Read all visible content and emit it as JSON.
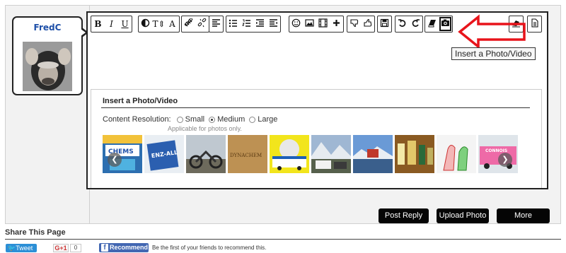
{
  "user": {
    "name": "FredC"
  },
  "toolbar": {
    "groups": [
      {
        "buttons": [
          {
            "name": "bold-button",
            "glyph": "B",
            "cls": "b"
          },
          {
            "name": "italic-button",
            "glyph": "I",
            "cls": "i"
          },
          {
            "name": "underline-button",
            "glyph": "U",
            "cls": "u"
          }
        ]
      },
      {
        "buttons": [
          {
            "name": "color-button",
            "icon": "half-circle"
          },
          {
            "name": "font-size-button",
            "glyph": "T⇕"
          },
          {
            "name": "font-button",
            "glyph": "A"
          }
        ]
      },
      {
        "buttons": [
          {
            "name": "link-button",
            "icon": "link"
          },
          {
            "name": "unlink-button",
            "icon": "unlink"
          }
        ]
      },
      {
        "buttons": [
          {
            "name": "align-button",
            "icon": "align-left"
          }
        ]
      },
      {
        "buttons": [
          {
            "name": "bullet-list-button",
            "icon": "ul"
          },
          {
            "name": "numbered-list-button",
            "icon": "ol"
          },
          {
            "name": "outdent-button",
            "icon": "outdent"
          },
          {
            "name": "indent-button",
            "icon": "indent"
          }
        ]
      },
      {
        "buttons": [
          {
            "name": "smilie-button",
            "icon": "smile"
          },
          {
            "name": "image-button",
            "icon": "image"
          },
          {
            "name": "media-button",
            "icon": "film"
          },
          {
            "name": "insert-more-button",
            "icon": "plus"
          }
        ]
      },
      {
        "buttons": [
          {
            "name": "thumbs-down-button",
            "icon": "thumb-down"
          },
          {
            "name": "thumbs-up-button",
            "icon": "thumb-up"
          }
        ]
      },
      {
        "buttons": [
          {
            "name": "save-draft-button",
            "icon": "floppy"
          }
        ]
      },
      {
        "buttons": [
          {
            "name": "undo-button",
            "icon": "undo"
          },
          {
            "name": "redo-button",
            "icon": "redo"
          }
        ]
      },
      {
        "buttons": [
          {
            "name": "book-button",
            "icon": "book"
          },
          {
            "name": "insert-photo-button",
            "icon": "camera",
            "active": true
          }
        ]
      },
      {
        "buttons": [
          {
            "name": "eraser-button",
            "icon": "eraser"
          }
        ]
      },
      {
        "buttons": [
          {
            "name": "document-button",
            "icon": "doc"
          }
        ]
      }
    ],
    "tooltip": "Insert a Photo/Video"
  },
  "photo_pane": {
    "title": "Insert a Photo/Video",
    "resolution_label": "Content Resolution:",
    "options": [
      {
        "label": "Small",
        "selected": false
      },
      {
        "label": "Medium",
        "selected": true
      },
      {
        "label": "Large",
        "selected": false
      }
    ],
    "note": "Applicable for photos only.",
    "thumbs": [
      {
        "name": "thumb-chemsource",
        "text": "CHEMS"
      },
      {
        "name": "thumb-enz-all",
        "text": "ENZ-ALL"
      },
      {
        "name": "thumb-motorcycle",
        "text": ""
      },
      {
        "name": "thumb-dynachem",
        "text": "DYNACHEM"
      },
      {
        "name": "thumb-van-sign",
        "text": ""
      },
      {
        "name": "thumb-mountain-trucks",
        "text": ""
      },
      {
        "name": "thumb-lake-mountains",
        "text": ""
      },
      {
        "name": "thumb-bottles",
        "text": ""
      },
      {
        "name": "thumb-cartoon",
        "text": ""
      },
      {
        "name": "thumb-pink-van",
        "text": "CONNOIS"
      }
    ],
    "prev_glyph": "❮",
    "next_glyph": "❯"
  },
  "actions": {
    "post_reply": "Post Reply",
    "upload_photo": "Upload Photo",
    "more_options": "More Options..."
  },
  "share": {
    "title": "Share This Page",
    "tweet": "Tweet",
    "gplus": "G+1",
    "gplus_count": "0",
    "fb_button": "Recommend",
    "fb_text": "Be the first of your friends to recommend this."
  }
}
